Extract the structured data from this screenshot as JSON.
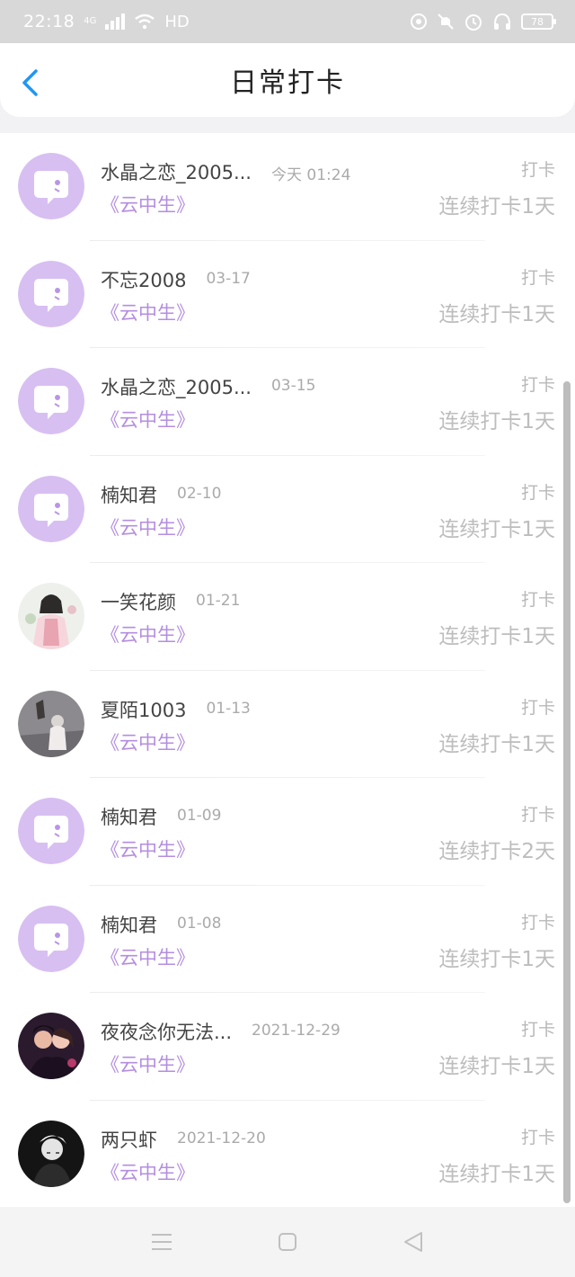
{
  "status_bar": {
    "time": "22:18",
    "network": "4G",
    "wifi_label": "HD",
    "battery": "78",
    "icons": [
      "signal-icon",
      "wifi-icon",
      "eye-icon",
      "mute-icon",
      "alarm-icon",
      "headphones-icon",
      "battery-icon"
    ]
  },
  "header": {
    "title": "日常打卡",
    "back_icon": "chevron-left-icon",
    "accent": "#2196F3"
  },
  "colors": {
    "book": "#b48ee0",
    "avatar_default_bg": "#d7bff2"
  },
  "items": [
    {
      "name": "水晶之恋_2005...",
      "date": "今天 01:24",
      "book": "《云中生》",
      "action": "打卡",
      "streak": "连续打卡1天",
      "avatar": "default"
    },
    {
      "name": "不忘2008",
      "date": "03-17",
      "book": "《云中生》",
      "action": "打卡",
      "streak": "连续打卡1天",
      "avatar": "default"
    },
    {
      "name": "水晶之恋_2005...",
      "date": "03-15",
      "book": "《云中生》",
      "action": "打卡",
      "streak": "连续打卡1天",
      "avatar": "default"
    },
    {
      "name": "楠知君",
      "date": "02-10",
      "book": "《云中生》",
      "action": "打卡",
      "streak": "连续打卡1天",
      "avatar": "default"
    },
    {
      "name": "一笑花颜",
      "date": "01-21",
      "book": "《云中生》",
      "action": "打卡",
      "streak": "连续打卡1天",
      "avatar": "photo-girl"
    },
    {
      "name": "夏陌1003",
      "date": "01-13",
      "book": "《云中生》",
      "action": "打卡",
      "streak": "连续打卡1天",
      "avatar": "photo-grey"
    },
    {
      "name": "楠知君",
      "date": "01-09",
      "book": "《云中生》",
      "action": "打卡",
      "streak": "连续打卡2天",
      "avatar": "default"
    },
    {
      "name": "楠知君",
      "date": "01-08",
      "book": "《云中生》",
      "action": "打卡",
      "streak": "连续打卡1天",
      "avatar": "default"
    },
    {
      "name": "夜夜念你无法...",
      "date": "2021-12-29",
      "book": "《云中生》",
      "action": "打卡",
      "streak": "连续打卡1天",
      "avatar": "photo-couple"
    },
    {
      "name": "两只虾",
      "date": "2021-12-20",
      "book": "《云中生》",
      "action": "打卡",
      "streak": "连续打卡1天",
      "avatar": "photo-dark"
    }
  ],
  "nav_bar": {
    "icons": [
      "menu-icon",
      "home-square-icon",
      "back-triangle-icon"
    ]
  }
}
